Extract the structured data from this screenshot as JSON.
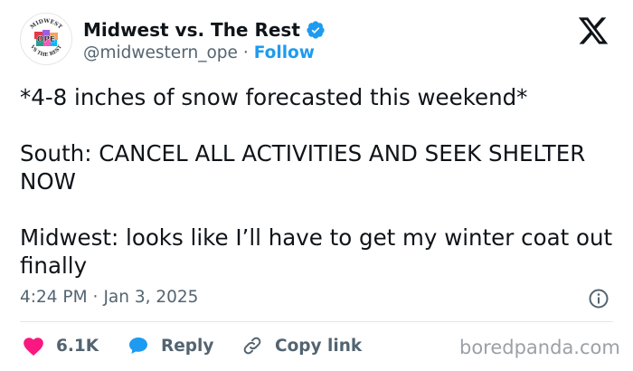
{
  "author": {
    "display_name": "Midwest vs. The Rest",
    "handle": "@midwestern_ope",
    "separator": "·",
    "follow_label": "Follow",
    "verified": true,
    "avatar": {
      "top_arc_text": "MIDWEST",
      "center_text": "OPE",
      "bottom_arc_text": "VS THE REST"
    }
  },
  "tweet": {
    "paragraphs": [
      "*4-8 inches of snow forecasted this weekend*",
      "South: CANCEL ALL ACTIVITIES AND SEEK SHELTER NOW",
      "Midwest: looks like I’ll have to get my winter coat out finally"
    ],
    "time": "4:24 PM",
    "separator": "·",
    "date": "Jan 3, 2025"
  },
  "actions": {
    "like_count": "6.1K",
    "reply_label": "Reply",
    "copy_link_label": "Copy link"
  },
  "watermark": "boredpanda.com",
  "colors": {
    "accent": "#1d9bf0",
    "like": "#f91880",
    "text": "#0f1419",
    "muted": "#536471"
  },
  "icons": [
    "verified-badge-icon",
    "x-logo-icon",
    "info-icon",
    "heart-icon",
    "reply-bubble-icon",
    "link-icon"
  ]
}
